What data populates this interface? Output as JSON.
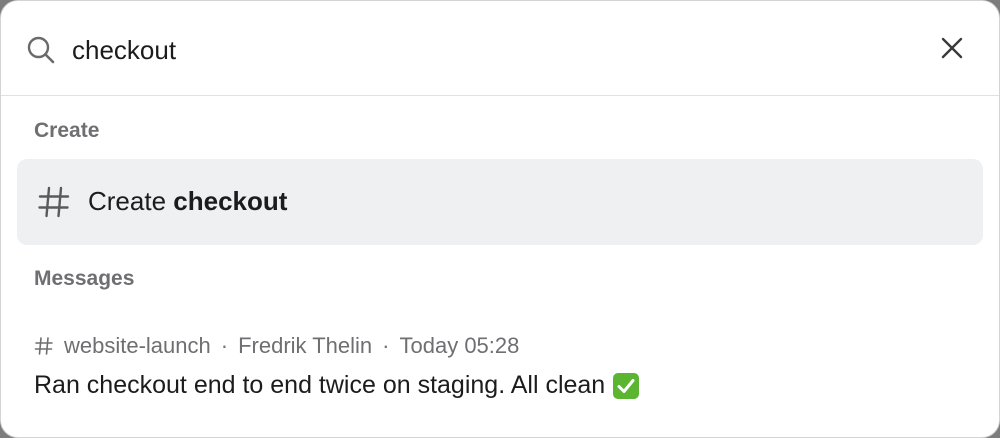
{
  "search": {
    "value": "checkout",
    "icon": "search-icon",
    "close_icon": "close-icon"
  },
  "sections": {
    "create_label": "Create",
    "messages_label": "Messages"
  },
  "create_item": {
    "icon": "hash-icon",
    "prefix": "Create",
    "term": "checkout",
    "highlight_color": "#eef0f2"
  },
  "messages": [
    {
      "channel": "website-launch",
      "author": "Fredrik Thelin",
      "timestamp": "Today 05:28",
      "separator": "·",
      "text": "Ran checkout end to end twice on staging. All clean",
      "emoji": "white-check-mark-icon"
    }
  ],
  "colors": {
    "text": "#1d1c1d",
    "muted": "#6f6f72",
    "emoji_green": "#5bb531"
  }
}
